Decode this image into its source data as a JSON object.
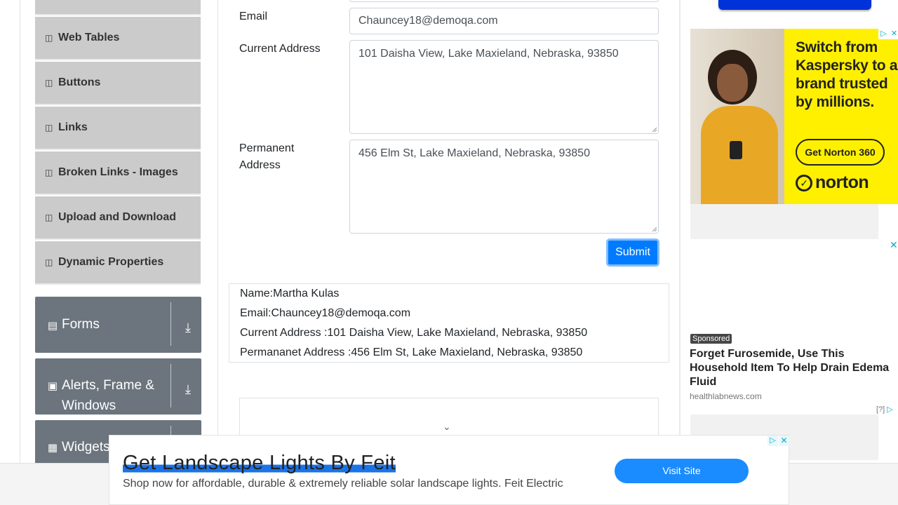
{
  "sidebar": {
    "items": [
      {
        "label": "Web Tables"
      },
      {
        "label": "Buttons"
      },
      {
        "label": "Links"
      },
      {
        "label": "Broken Links - Images"
      },
      {
        "label": "Upload and Download"
      },
      {
        "label": "Dynamic Properties"
      }
    ],
    "groups": [
      {
        "label": "Forms"
      },
      {
        "label": "Alerts, Frame & Windows"
      },
      {
        "label": "Widgets"
      }
    ]
  },
  "form": {
    "email_label": "Email",
    "email_value": "Chauncey18@demoqa.com",
    "current_address_label": "Current Address",
    "current_address_value": "101 Daisha View, Lake Maxieland, Nebraska, 93850",
    "permanent_address_label": "Permanent Address",
    "permanent_address_value": "456 Elm St, Lake Maxieland, Nebraska, 93850",
    "submit_label": "Submit"
  },
  "output": {
    "name": "Name:Martha Kulas",
    "email": "Email:Chauncey18@demoqa.com",
    "current_address": "Current Address :101 Daisha View, Lake Maxieland, Nebraska, 93850",
    "permanent_address": "Permananet Address :456 Elm St, Lake Maxieland, Nebraska, 93850"
  },
  "ads": {
    "norton": {
      "headline": "Switch from Kaspersky to a brand trusted by millions.",
      "cta": "Get Norton 360",
      "logo": "norton"
    },
    "sponsored": {
      "badge": "Sponsored",
      "title": "Forget Furosemide, Use This Household Item To Help Drain Edema Fluid",
      "source": "healthlabnews.com",
      "help": "[?]"
    },
    "banner": {
      "title": "Get Landscape Lights By Feit",
      "subtitle": "Shop now for affordable, durable & extremely reliable solar landscape lights. Feit Electric",
      "button": "Visit Site"
    }
  },
  "colors": {
    "primary": "#007bff",
    "sidebar_item_bg": "#cbcbcb",
    "group_bg": "#6c757d",
    "norton_yellow": "#fff000",
    "banner_button": "#1a8cff"
  }
}
